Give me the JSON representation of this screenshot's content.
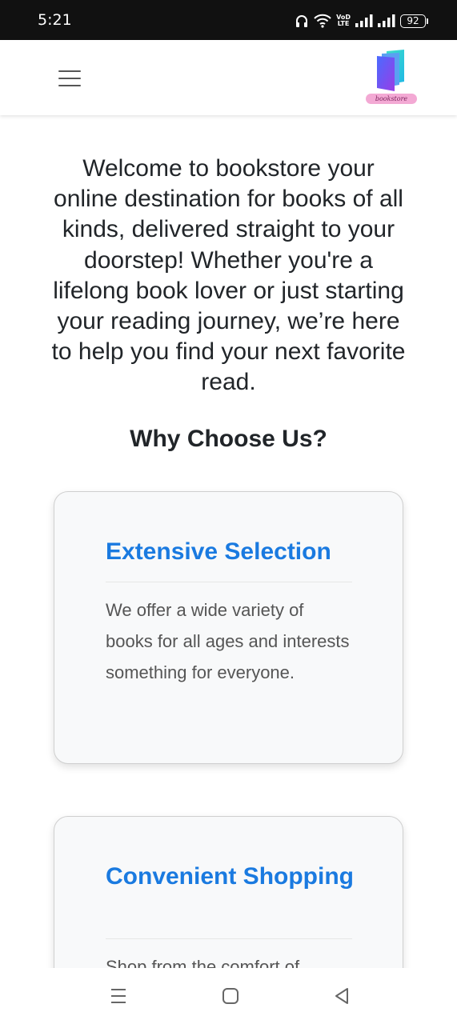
{
  "status_bar": {
    "time": "5:21",
    "volte_line1": "VoD",
    "volte_line2": "LTE",
    "battery": "92"
  },
  "header": {
    "menu_icon": "hamburger-menu-icon",
    "logo_icon": "book-logo-icon",
    "logo_text": "bookstore"
  },
  "main": {
    "intro": "Welcome to bookstore your online destination for books of all kinds, delivered straight to your doorstep! Whether you're a lifelong book lover or just starting your reading journey, we’re here to help you find your next favorite read.",
    "section_heading": "Why Choose Us?",
    "features": [
      {
        "title": "Extensive Selection",
        "description": "We offer a wide variety of books for all ages and interests something for everyone."
      },
      {
        "title": "Convenient Shopping",
        "description": "Shop from the comfort of"
      }
    ]
  },
  "nav_bar": {
    "recent_icon": "recent-apps-icon",
    "home_icon": "home-icon",
    "back_icon": "back-icon"
  },
  "colors": {
    "accent": "#1a7ae0",
    "text": "#212529",
    "muted_text": "#555555",
    "card_background": "#f8f9fa",
    "status_bar": "#111111"
  }
}
